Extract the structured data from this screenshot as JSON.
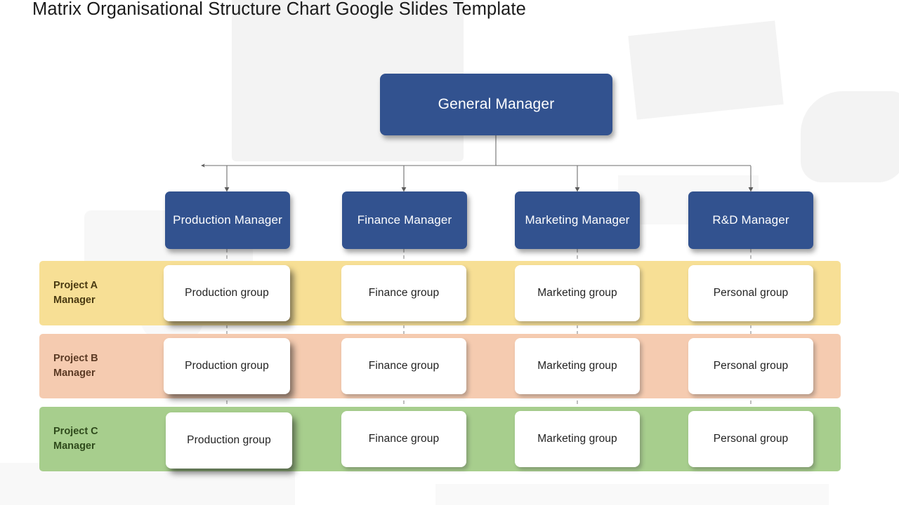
{
  "title": "Matrix Organisational Structure Chart Google Slides Template",
  "colors": {
    "node_blue": "#32528F",
    "node_text": "#FFFFFF",
    "band_a": "#F7DF95",
    "band_b": "#F5CBB0",
    "band_c": "#A7CE8D",
    "card_bg": "#FFFFFF",
    "card_text": "#232323",
    "connector": "#6E6E6E",
    "page_bg": "#FFFFFF"
  },
  "chart_data": {
    "type": "diagram",
    "diagram_type": "matrix-organisational-structure-chart",
    "title": "Matrix Organisational Structure Chart Google Slides Template",
    "root": {
      "label": "General Manager"
    },
    "functional_managers": [
      {
        "label": "Production Manager"
      },
      {
        "label": "Finance Manager"
      },
      {
        "label": "Marketing Manager"
      },
      {
        "label": "R&D Manager"
      }
    ],
    "project_rows": [
      {
        "label": "Project A\nManager",
        "color": "#F7DF95",
        "cells": [
          "Production group",
          "Finance group",
          "Marketing group",
          "Personal group"
        ]
      },
      {
        "label": "Project B\nManager",
        "color": "#F5CBB0",
        "cells": [
          "Production group",
          "Finance group",
          "Marketing group",
          "Personal group"
        ]
      },
      {
        "label": "Project C\nManager",
        "color": "#A7CE8D",
        "cells": [
          "Production group",
          "Finance group",
          "Marketing group",
          "Personal group"
        ]
      }
    ],
    "connectors": {
      "root_to_managers": "solid lines with arrowheads",
      "managers_down_columns": "dashed vertical lines through all project rows"
    }
  }
}
